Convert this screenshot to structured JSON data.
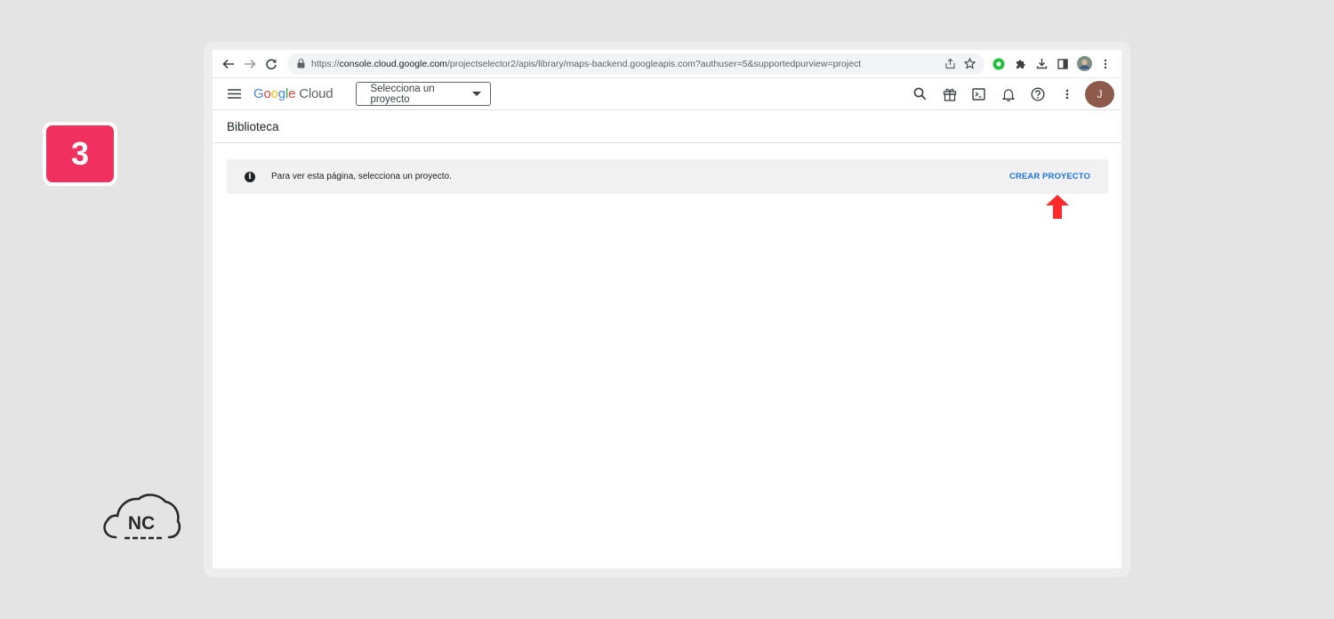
{
  "step": {
    "number": "3"
  },
  "watermark": {
    "text": "NC"
  },
  "browser": {
    "url_scheme": "https://",
    "url_host": "console.cloud.google.com",
    "url_path": "/projectselector2/apis/library/maps-backend.googleapis.com?authuser=5&supportedpurview=project"
  },
  "header": {
    "logo_letters": [
      "G",
      "o",
      "o",
      "g",
      "l",
      "e"
    ],
    "logo_cloud": "Cloud",
    "project_select_label": "Selecciona un proyecto",
    "avatar_initial": "J"
  },
  "page": {
    "title": "Biblioteca"
  },
  "notice": {
    "icon": "info-icon",
    "message": "Para ver esta página, selecciona un proyecto.",
    "action_label": "CREAR PROYECTO"
  },
  "colors": {
    "background": "#e4e4e4",
    "step_badge": "#f0305e",
    "link_blue": "#1a73e8",
    "annotation_arrow": "#ff2b2b",
    "avatar": "#8d5a4b"
  }
}
